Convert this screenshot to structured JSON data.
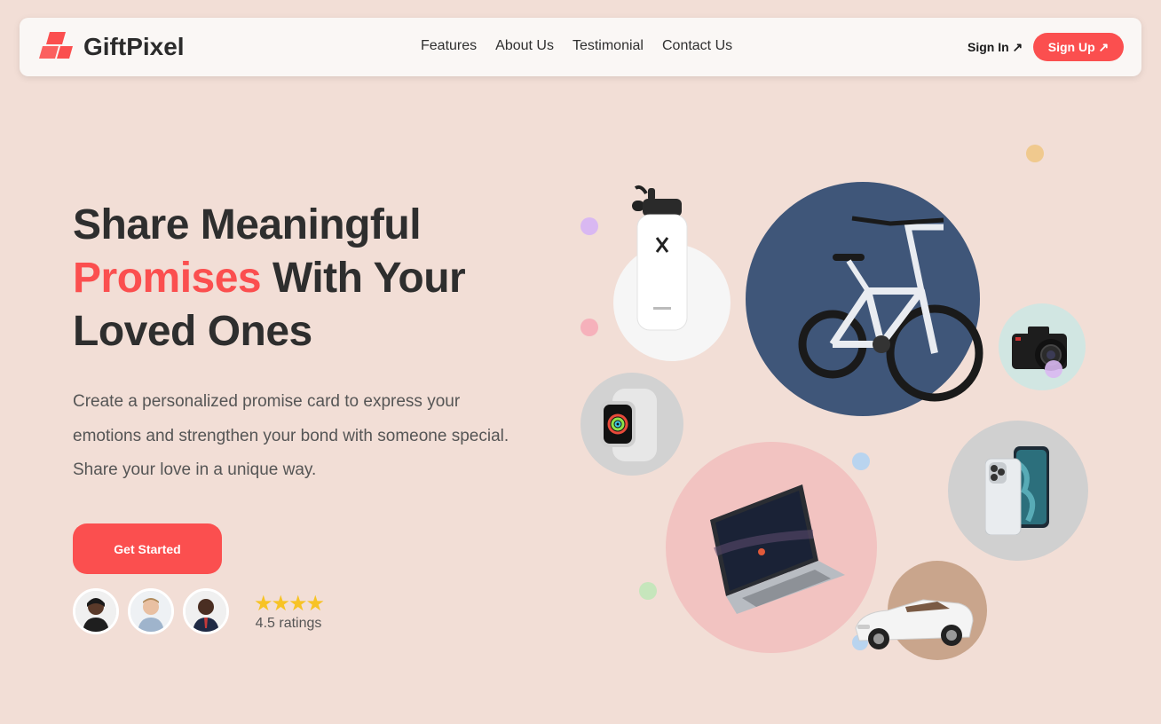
{
  "brand": {
    "name": "GiftPixel",
    "accent_color": "#fb4f4f"
  },
  "nav": {
    "links": [
      "Features",
      "About Us",
      "Testimonial",
      "Contact Us"
    ],
    "signin_label": "Sign In ↗",
    "signup_label": "Sign Up ↗"
  },
  "hero": {
    "title_line1": "Share Meaningful",
    "title_accent": "Promises",
    "title_line2_rest": " With Your",
    "title_line3": "Loved Ones",
    "description": "Create a personalized promise card to express your emotions and strengthen your bond with someone special. Share your love in a unique way.",
    "cta_label": "Get Started"
  },
  "social_proof": {
    "stars": "★★★★",
    "rating_text": "4.5 ratings"
  },
  "products": [
    "water-bottle",
    "bicycle",
    "camera",
    "smartwatch",
    "smartphone",
    "laptop",
    "convertible-car"
  ]
}
